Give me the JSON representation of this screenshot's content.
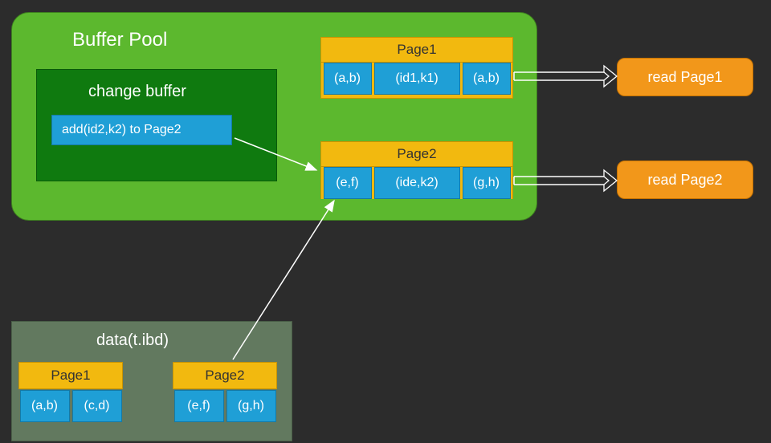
{
  "bufferPool": {
    "title": "Buffer Pool",
    "changeBuffer": {
      "title": "change buffer",
      "item": "add(id2,k2) to Page2"
    },
    "page1": {
      "title": "Page1",
      "cells": [
        "(a,b)",
        "(id1,k1)",
        "(a,b)"
      ]
    },
    "page2": {
      "title": "Page2",
      "cells": [
        "(e,f)",
        "(ide,k2)",
        "(g,h)"
      ]
    }
  },
  "readBtns": {
    "read1": "read Page1",
    "read2": "read Page2"
  },
  "dataFile": {
    "title": "data(t.ibd)",
    "page1": {
      "title": "Page1",
      "cells": [
        "(a,b)",
        "(c,d)"
      ]
    },
    "page2": {
      "title": "Page2",
      "cells": [
        "(e,f)",
        "(g,h)"
      ]
    }
  }
}
